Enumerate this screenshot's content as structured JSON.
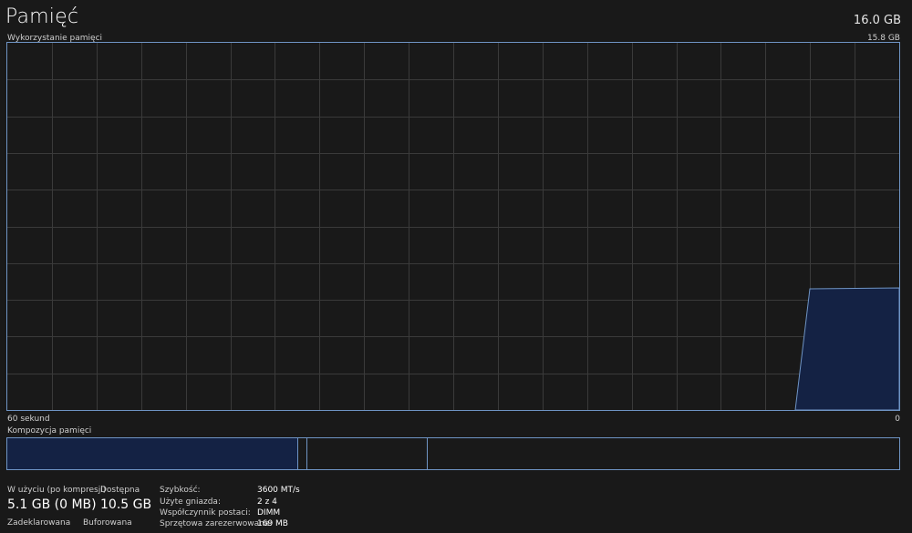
{
  "header": {
    "title": "Pamięć",
    "total": "16.0 GB"
  },
  "usage_graph": {
    "label": "Wykorzystanie pamięci",
    "max_label": "15.8 GB",
    "time_label": "60 sekund",
    "min_label": "0",
    "fill_color": "#142244",
    "line_color": "#6f94c4"
  },
  "composition": {
    "label": "Kompozycja pamięci"
  },
  "stats": {
    "in_use_label": "W użyciu (po kompresji)",
    "in_use_value": "5.1 GB (0 MB)",
    "available_label": "Dostępna",
    "available_value": "10.5 GB",
    "committed_label": "Zadeklarowana",
    "cached_label": "Buforowana"
  },
  "details": [
    {
      "label": "Szybkość:",
      "value": "3600 MT/s"
    },
    {
      "label": "Użyte gniazda:",
      "value": "2 z 4"
    },
    {
      "label": "Współczynnik postaci:",
      "value": "DIMM"
    },
    {
      "label": "Sprzętowa zarezerwowana:",
      "value": "169 MB"
    }
  ]
}
